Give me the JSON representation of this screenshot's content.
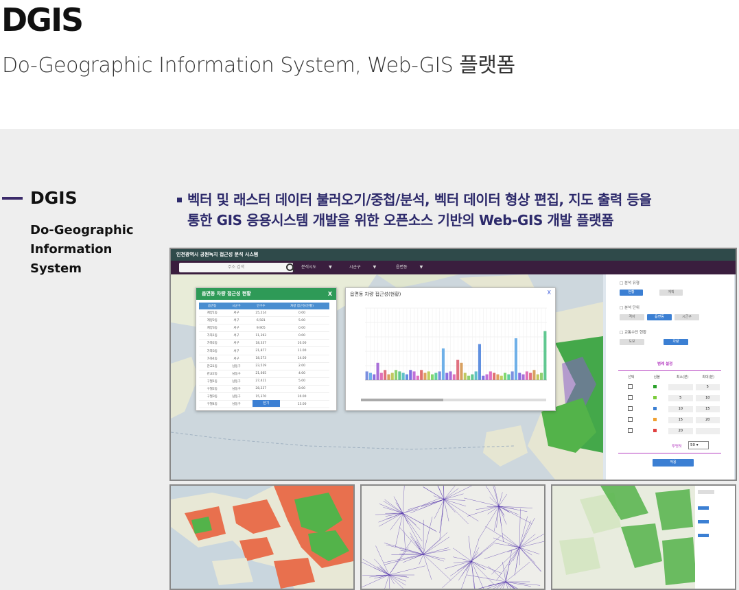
{
  "header": {
    "title": "DGIS",
    "subtitle": "Do-Geographic Information System, Web-GIS 플랫폼"
  },
  "sidebar": {
    "title": "DGIS",
    "subtitle": "Do-Geographic Information System"
  },
  "description": {
    "line1": "벡터 및 래스터 데이터 불러오기/중첩/분석, 벡터 데이터 형상 편집, 지도 출력 등을",
    "line2": "통한 GIS 응용시스템 개발을 위한 오픈소스 기반의 Web-GIS 개발 플랫폼"
  },
  "app": {
    "window_title": "인천광역시 공원녹지 접근성 분석 시스템",
    "search_placeholder": "주소 검색",
    "selects": [
      "분석시도",
      "시군구",
      "읍면동"
    ],
    "table_popup": {
      "title": "읍면동 차량 접근성 현황",
      "close_label": "X",
      "columns": [
        "읍면동",
        "시군구",
        "인구수",
        "차량 접근성(현황)"
      ],
      "rows": [
        [
          "계양1동",
          "서구",
          "25,214",
          "0.00"
        ],
        [
          "계양2동",
          "서구",
          "6,581",
          "5.00"
        ],
        [
          "계양3동",
          "서구",
          "9,905",
          "0.00"
        ],
        [
          "가좌1동",
          "서구",
          "11,393",
          "0.00"
        ],
        [
          "가좌2동",
          "서구",
          "18,337",
          "10.00"
        ],
        [
          "가좌3동",
          "서구",
          "21,877",
          "11.00"
        ],
        [
          "가좌4동",
          "서구",
          "18,573",
          "14.00"
        ],
        [
          "관교1동",
          "남동구",
          "23,519",
          "2.00"
        ],
        [
          "관교2동",
          "남동구",
          "21,665",
          "4.00"
        ],
        [
          "구월1동",
          "남동구",
          "27,411",
          "5.00"
        ],
        [
          "구월2동",
          "남동구",
          "28,237",
          "8.00"
        ],
        [
          "구월3동",
          "남동구",
          "15,370",
          "10.00"
        ],
        [
          "구월4동",
          "남동구",
          "29,493",
          "13.00"
        ]
      ],
      "button_label": "닫기"
    },
    "chart_popup": {
      "title": "읍면동 차량 접근성(현황)",
      "close_label": "X"
    },
    "right_panel": {
      "section1": "분석 유형",
      "section1_options": [
        "현황",
        "계획"
      ],
      "section2": "분석 단위",
      "section2_options": [
        "격자",
        "읍면동",
        "시군구"
      ],
      "section3": "교통수단 현황",
      "section3_options": [
        "도보",
        "차량"
      ],
      "legend_title": "범례 설정",
      "legend_cols": [
        "선택",
        "심볼",
        "최소(분)",
        "최대(분)"
      ],
      "legend_rows": [
        {
          "color": "#2aa12a",
          "min": "",
          "max": "5"
        },
        {
          "color": "#7ccc3c",
          "min": "5",
          "max": "10"
        },
        {
          "color": "#3b7fd3",
          "min": "10",
          "max": "15"
        },
        {
          "color": "#f0a030",
          "min": "15",
          "max": "20"
        },
        {
          "color": "#e04040",
          "min": "20",
          "max": ""
        }
      ],
      "opacity_label": "투명도",
      "opacity_value": "50",
      "apply_label": "적용"
    }
  },
  "chart_data": {
    "type": "bar",
    "title": "읍면동 차량 접근성(현황)",
    "ylim": [
      0,
      100
    ],
    "values": [
      12,
      10,
      8,
      24,
      10,
      14,
      8,
      10,
      14,
      12,
      10,
      8,
      14,
      12,
      6,
      14,
      10,
      12,
      8,
      10,
      12,
      44,
      10,
      12,
      8,
      28,
      24,
      10,
      6,
      8,
      12,
      50,
      6,
      8,
      12,
      10,
      8,
      6,
      10,
      8,
      12,
      58,
      10,
      8,
      12,
      10,
      14,
      8,
      10,
      68
    ],
    "colors": [
      "#7b8fe0",
      "#6fb0e8",
      "#8a6fe0",
      "#a86fd8",
      "#e070b8",
      "#e07080",
      "#d8a060",
      "#c0c860",
      "#90d070",
      "#60c890",
      "#60c0c8",
      "#6090e0",
      "#8070e0",
      "#c070d8",
      "#e070c0",
      "#e07070",
      "#e0a060",
      "#c0d060",
      "#80d870",
      "#60d0a0"
    ]
  }
}
